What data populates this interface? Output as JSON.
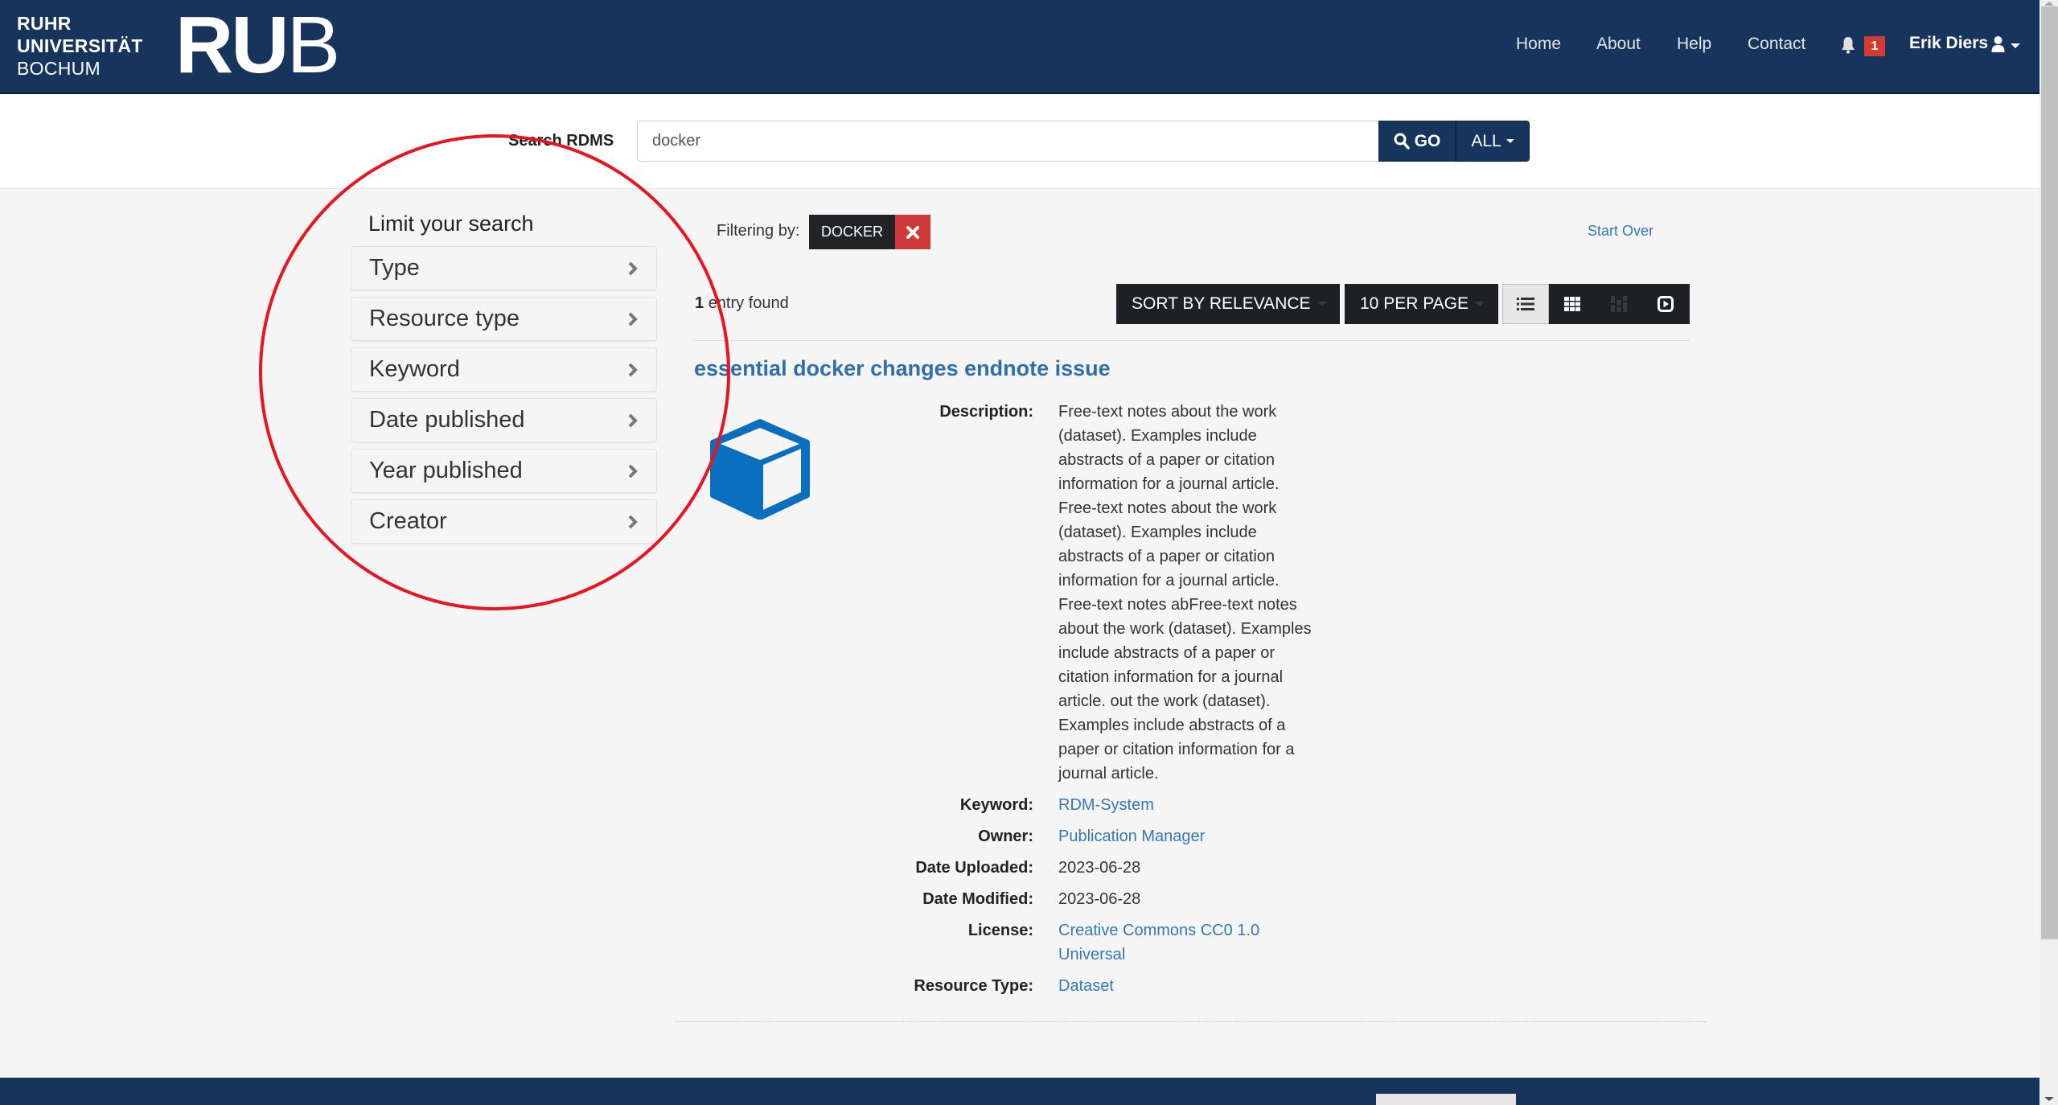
{
  "header": {
    "logo": {
      "line1": "RUHR",
      "line2": "UNIVERSITÄT",
      "line3": "BOCHUM",
      "mark_bold": "RU",
      "mark_light": "B"
    },
    "nav": [
      {
        "label": "Home"
      },
      {
        "label": "About"
      },
      {
        "label": "Help"
      },
      {
        "label": "Contact"
      }
    ],
    "notifications": {
      "icon": "bell-icon",
      "count": "1"
    },
    "user": {
      "name": "Erik Diers",
      "icon": "user-icon"
    }
  },
  "search": {
    "label": "Search RDMS",
    "value": "docker",
    "go_label": "GO",
    "scope_label": "ALL"
  },
  "facets": {
    "title": "Limit your search",
    "items": [
      {
        "label": "Type"
      },
      {
        "label": "Resource type"
      },
      {
        "label": "Keyword"
      },
      {
        "label": "Date published"
      },
      {
        "label": "Year published"
      },
      {
        "label": "Creator"
      }
    ]
  },
  "filters": {
    "label": "Filtering by:",
    "active": [
      {
        "value": "DOCKER"
      }
    ],
    "start_over": "Start Over"
  },
  "results_header": {
    "count": "1",
    "count_suffix": "entry found",
    "sort_label": "SORT BY RELEVANCE",
    "per_page_label": "10 PER PAGE",
    "views": [
      {
        "name": "list-view",
        "active": true
      },
      {
        "name": "gallery-view",
        "active": false
      },
      {
        "name": "masonry-view",
        "active": false
      },
      {
        "name": "slideshow-view",
        "active": false
      }
    ]
  },
  "result": {
    "title": "essential docker changes endnote issue",
    "thumbnail_icon": "cube-icon",
    "fields": {
      "description_key": "Description:",
      "description_val": "Free-text notes about the work (dataset). Examples include abstracts of a paper or citation information for a journal article. Free-text notes about the work (dataset). Examples include abstracts of a paper or citation information for a journal article. Free-text notes abFree-text notes about the work (dataset). Examples include abstracts of a paper or citation information for a journal article. out the work (dataset). Examples include abstracts of a paper or citation information for a journal article.",
      "keyword_key": "Keyword:",
      "keyword_val": "RDM-System",
      "owner_key": "Owner:",
      "owner_val": "Publication Manager",
      "uploaded_key": "Date Uploaded:",
      "uploaded_val": "2023-06-28",
      "modified_key": "Date Modified:",
      "modified_val": "2023-06-28",
      "license_key": "License:",
      "license_val": "Creative Commons CC0 1.0 Universal",
      "restype_key": "Resource Type:",
      "restype_val": "Dataset"
    }
  },
  "colors": {
    "brand_navy": "#17355c",
    "link_blue": "#3478b7",
    "danger_red": "#d0393a",
    "annotation_red": "#e8141f"
  }
}
